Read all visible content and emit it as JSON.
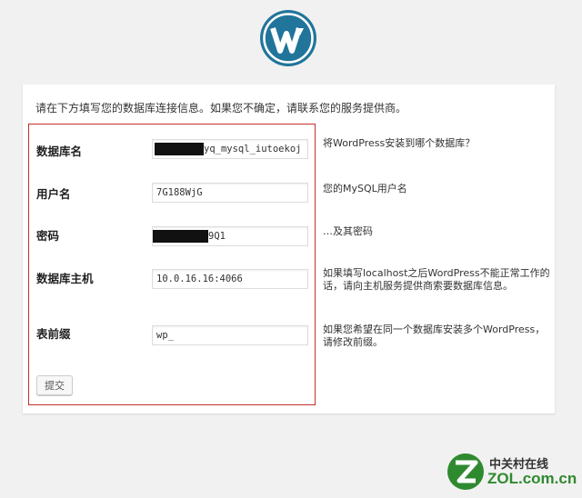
{
  "logo": {
    "icon": "wordpress-logo-icon",
    "color": "#21759b"
  },
  "intro": "请在下方填写您的数据库连接信息。如果您不确定，请联系您的服务提供商。",
  "fields": [
    {
      "label": "数据库名",
      "value": "yq_mysql_iutoekoj",
      "help": "将WordPress安装到哪个数据库？"
    },
    {
      "label": "用户名",
      "value": "7G188WjG",
      "help": "您的MySQL用户名"
    },
    {
      "label": "密码",
      "value": "9Q1",
      "help": "…及其密码"
    },
    {
      "label": "数据库主机",
      "value": "10.0.16.16:4066",
      "help": "如果填写localhost之后WordPress不能正常工作的话，请向主机服务提供商索要数据库信息。"
    },
    {
      "label": "表前缀",
      "value": "wp_",
      "help": "如果您希望在同一个数据库安装多个WordPress，请修改前缀。"
    }
  ],
  "submit_label": "提交",
  "watermark": {
    "top": "中关村在线",
    "bottom": "ZOL.com.cn",
    "icon": "zol-logo-icon"
  },
  "colors": {
    "highlight_border": "#c4302b",
    "wp_blue": "#21759b"
  }
}
